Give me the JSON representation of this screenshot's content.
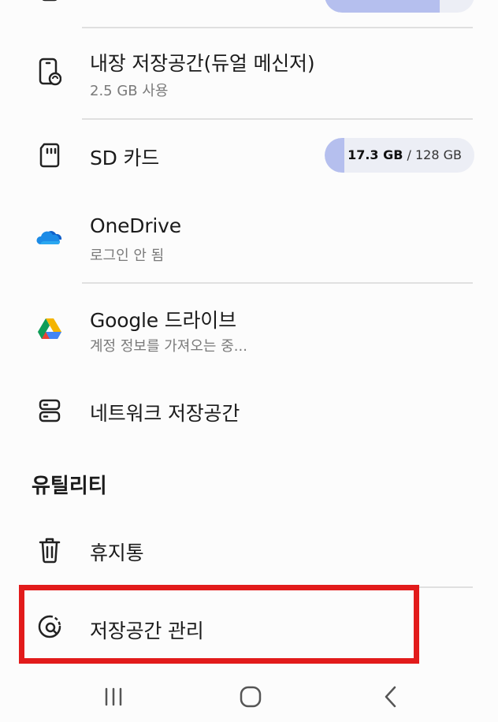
{
  "colors": {
    "accent": "#b5bfee",
    "highlight": "#e21b1b"
  },
  "storage": [
    {
      "title": "내장 저장공간(듀얼 메신저)",
      "subtitle": "2.5 GB 사용",
      "icon": "phone-dual-messenger-icon"
    },
    {
      "title": "SD 카드",
      "used": "17.3 GB",
      "total": "128 GB",
      "used_fraction": 0.135,
      "icon": "sd-card-icon"
    },
    {
      "title": "OneDrive",
      "subtitle": "로그인 안 됨",
      "icon": "onedrive-icon"
    },
    {
      "title": "Google 드라이브",
      "subtitle": "계정 정보를 가져오는 중...",
      "icon": "google-drive-icon"
    },
    {
      "title": "네트워크 저장공간",
      "icon": "network-storage-icon"
    }
  ],
  "top_storage_used_fraction": 0.8,
  "section_utilities": "유틸리티",
  "utilities": [
    {
      "title": "휴지통",
      "icon": "trash-icon"
    },
    {
      "title": "저장공간 관리",
      "icon": "storage-analyze-icon"
    }
  ],
  "navbar": [
    "recent-apps-icon",
    "home-icon",
    "back-icon"
  ]
}
